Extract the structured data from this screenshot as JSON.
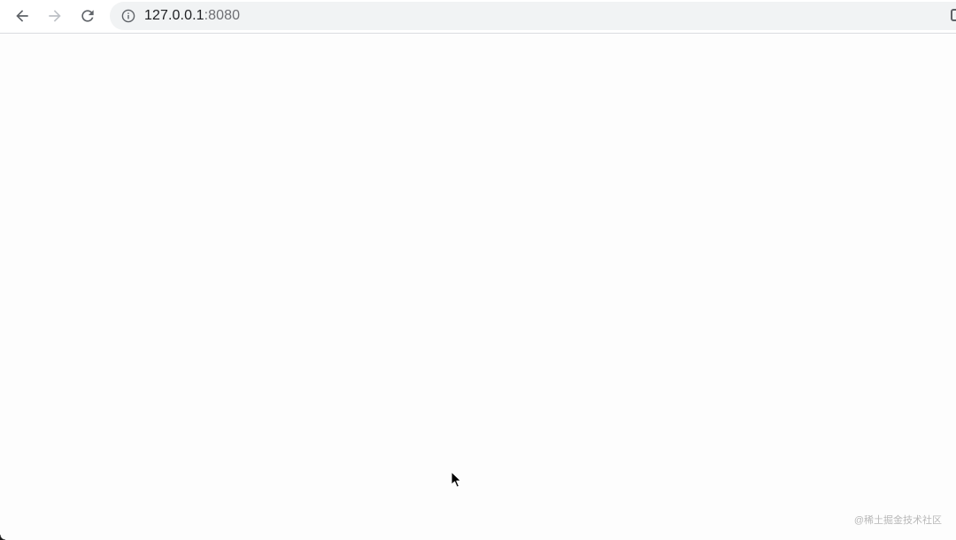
{
  "browser": {
    "url_host": "127.0.0.1",
    "url_port": ":8080",
    "icons": {
      "back": "arrow-left-icon",
      "forward": "arrow-right-icon",
      "reload": "reload-icon",
      "site_info": "info-icon",
      "extension": "extension-icon"
    },
    "forward_enabled": false
  },
  "page": {
    "watermark": "@稀土掘金技术社区"
  },
  "colors": {
    "toolbar_bg": "#ffffff",
    "omnibox_bg": "#f1f3f4",
    "icon": "#5f6368",
    "icon_disabled": "#bdc1c6",
    "page_bg": "#fdfdfd"
  }
}
